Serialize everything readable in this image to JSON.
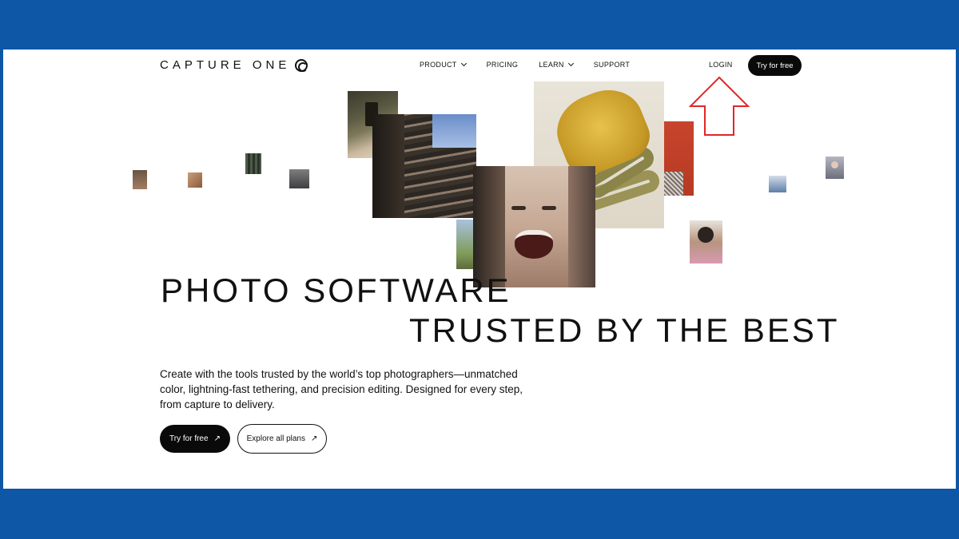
{
  "header": {
    "logo_text": "CAPTURE ONE",
    "nav": [
      {
        "label": "PRODUCT",
        "has_dropdown": true
      },
      {
        "label": "PRICING",
        "has_dropdown": false
      },
      {
        "label": "LEARN",
        "has_dropdown": true
      },
      {
        "label": "SUPPORT",
        "has_dropdown": false
      }
    ],
    "login_label": "LOGIN",
    "cta_label": "Try for free"
  },
  "hero": {
    "title_line1": "PHOTO SOFTWARE",
    "title_line2": "TRUSTED BY THE BEST",
    "description": "Create with the tools trusted by the world’s top photographers—unmatched color, lightning-fast tethering, and precision editing. Designed for every step, from capture to delivery.",
    "primary_button": "Try for free",
    "secondary_button": "Explore all plans",
    "button_icon": "arrow-up-right-icon"
  },
  "colors": {
    "frame": "#0d57a6",
    "annotation_arrow": "#e0262b",
    "button_dark": "#0a0a0a"
  }
}
